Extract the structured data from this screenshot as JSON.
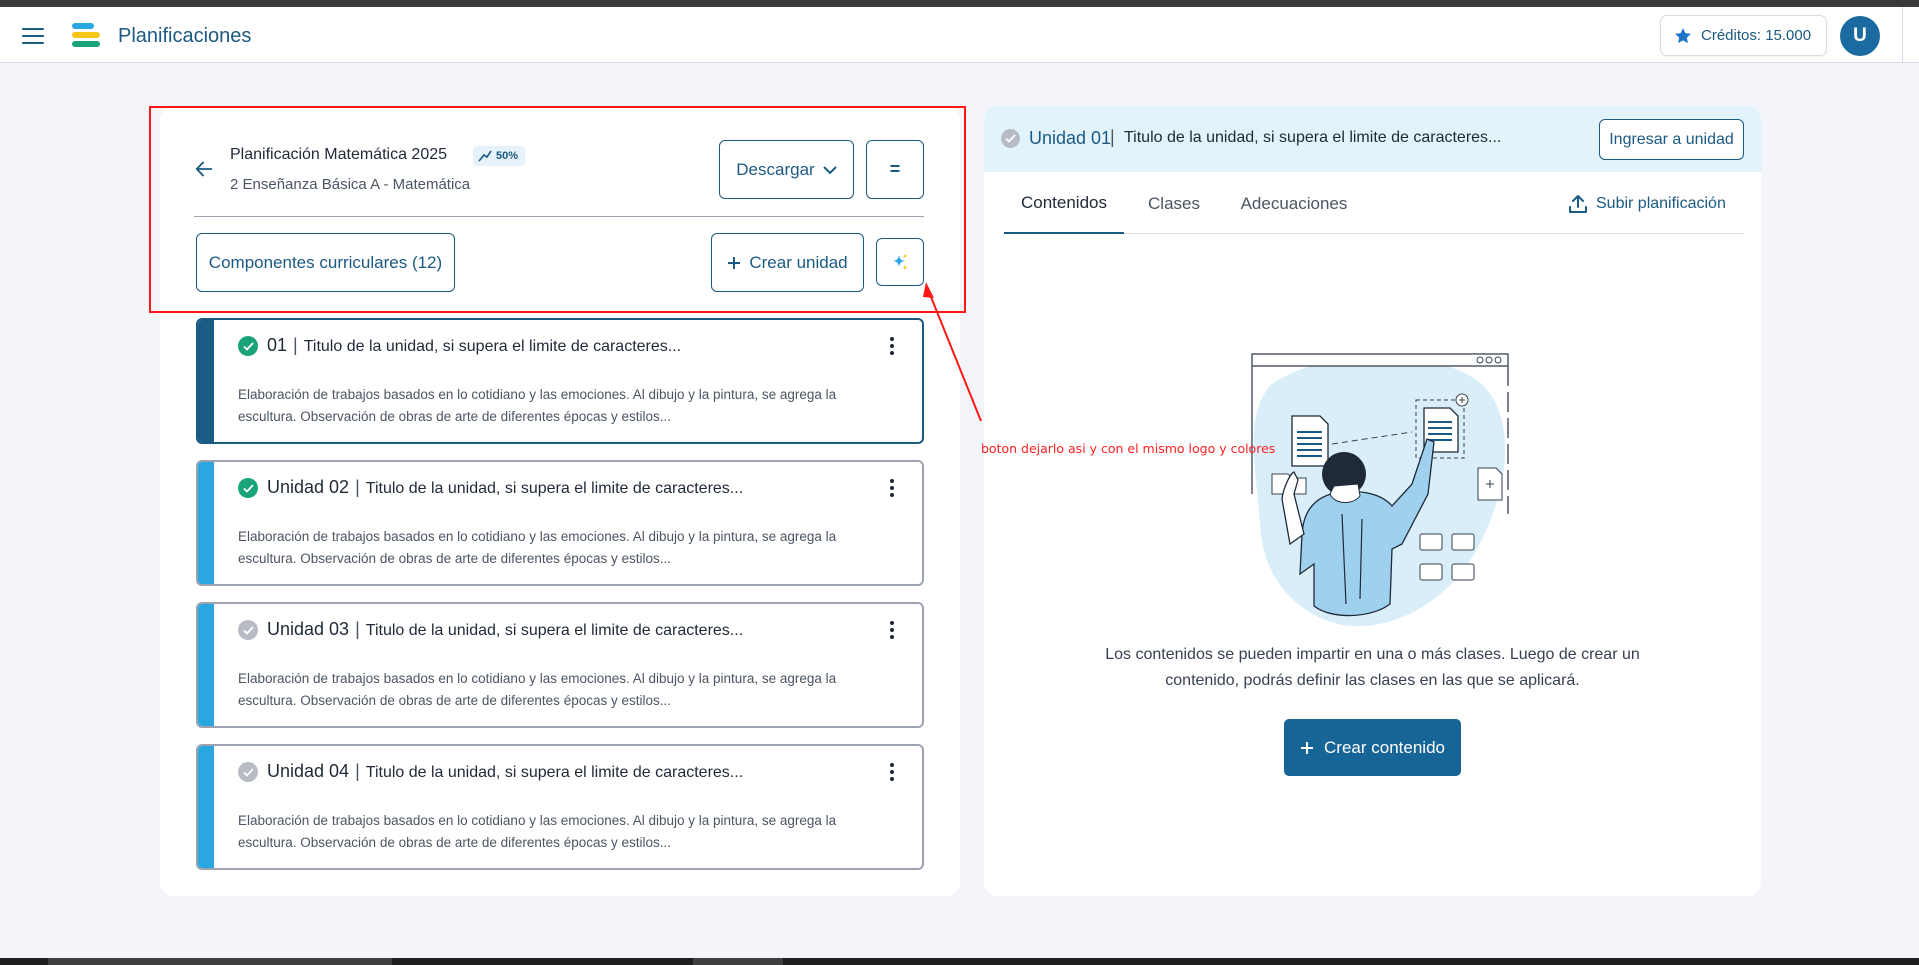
{
  "app": {
    "title": "Planificaciones",
    "credits_label": "Créditos: 15.000",
    "avatar_initial": "U"
  },
  "colors": {
    "primary": "#1b5a83",
    "accent_blue": "#2aa6e1",
    "success_green": "#1aa37a",
    "pending_gray": "#b7bcc4",
    "annotation_red": "#ff1616"
  },
  "planning": {
    "title": "Planificación Matemática 2025",
    "progress_label": "50%",
    "progress": 0.5,
    "subtitle": "2 Enseñanza Básica A - Matemática",
    "download_label": "Descargar",
    "menu_label": "=",
    "curricular_label": "Componentes curriculares (12)",
    "create_unit_label": "Crear unidad"
  },
  "units": [
    {
      "number": "01",
      "title": "Titulo de la unidad, si supera el limite de caracteres...",
      "description": "Elaboración de trabajos basados en lo cotidiano y las emociones. Al dibujo y la pintura, se agrega la escultura. Observación de obras de arte de diferentes épocas y estilos...",
      "status": "complete",
      "active": true
    },
    {
      "number": "Unidad 02",
      "title": "Titulo de la unidad, si supera el limite de caracteres...",
      "description": "Elaboración de trabajos basados en lo cotidiano y las emociones. Al dibujo y la pintura, se agrega la escultura. Observación de obras de arte de diferentes épocas y estilos...",
      "status": "complete",
      "active": false
    },
    {
      "number": "Unidad 03",
      "title": "Titulo de la unidad, si supera el limite de caracteres...",
      "description": "Elaboración de trabajos basados en lo cotidiano y las emociones. Al dibujo y la pintura, se agrega la escultura. Observación de obras de arte de diferentes épocas y estilos...",
      "status": "pending",
      "active": false
    },
    {
      "number": "Unidad 04",
      "title": "Titulo de la unidad, si supera el limite de caracteres...",
      "description": "Elaboración de trabajos basados en lo cotidiano y las emociones. Al dibujo y la pintura, se agrega la escultura. Observación de obras de arte de diferentes épocas y estilos...",
      "status": "pending",
      "active": false
    }
  ],
  "detail": {
    "unit_label": "Unidad 01",
    "unit_title": "Titulo de la unidad, si supera el limite de caracteres...",
    "enter_unit_label": "Ingresar a unidad",
    "tabs": [
      "Contenidos",
      "Clases",
      "Adecuaciones"
    ],
    "active_tab": "Contenidos",
    "upload_label": "Subir planificación",
    "empty_text": "Los contenidos se pueden impartir en una o más clases. Luego de crear un contenido, podrás definir las clases en las que se aplicará.",
    "create_content_label": "Crear contenido"
  },
  "annotation": {
    "note": "boton dejarlo asi y con el mismo logo y colores"
  }
}
